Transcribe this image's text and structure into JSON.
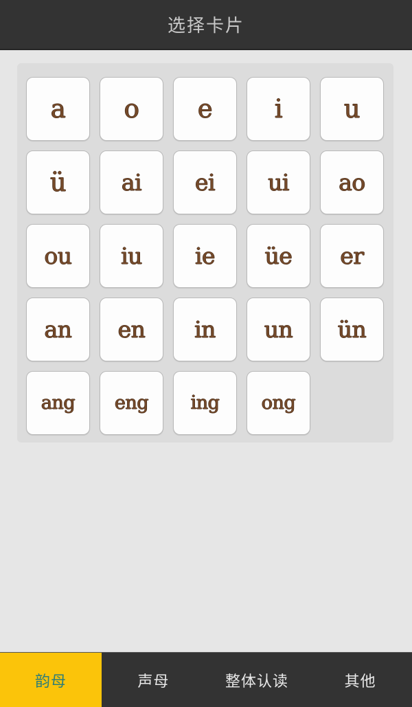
{
  "header": {
    "title": "选择卡片"
  },
  "colors": {
    "header_bg": "#333333",
    "page_bg": "#e6e6e6",
    "panel_bg": "#dcdcdc",
    "card_bg": "#fdfdfd",
    "card_border": "#b9b9b9",
    "glyph": "#754a2a",
    "glyph_outline": "#3d2413",
    "tab_bar_bg": "#333333",
    "tab_active_bg": "#FBC40A",
    "tab_active_text": "#2e7d78",
    "tab_text": "#e8e8e8",
    "title_text": "#c8c8c8"
  },
  "card_grid": {
    "rows": [
      [
        "a",
        "o",
        "e",
        "i",
        "u"
      ],
      [
        "ü",
        "ai",
        "ei",
        "ui",
        "ao"
      ],
      [
        "ou",
        "iu",
        "ie",
        "üe",
        "er"
      ],
      [
        "an",
        "en",
        "in",
        "un",
        "ün"
      ],
      [
        "ang",
        "eng",
        "ing",
        "ong"
      ]
    ]
  },
  "tab_bar": {
    "items": [
      {
        "label": "韵母",
        "active": true
      },
      {
        "label": "声母",
        "active": false
      },
      {
        "label": "整体认读",
        "active": false
      },
      {
        "label": "其他",
        "active": false
      }
    ]
  }
}
